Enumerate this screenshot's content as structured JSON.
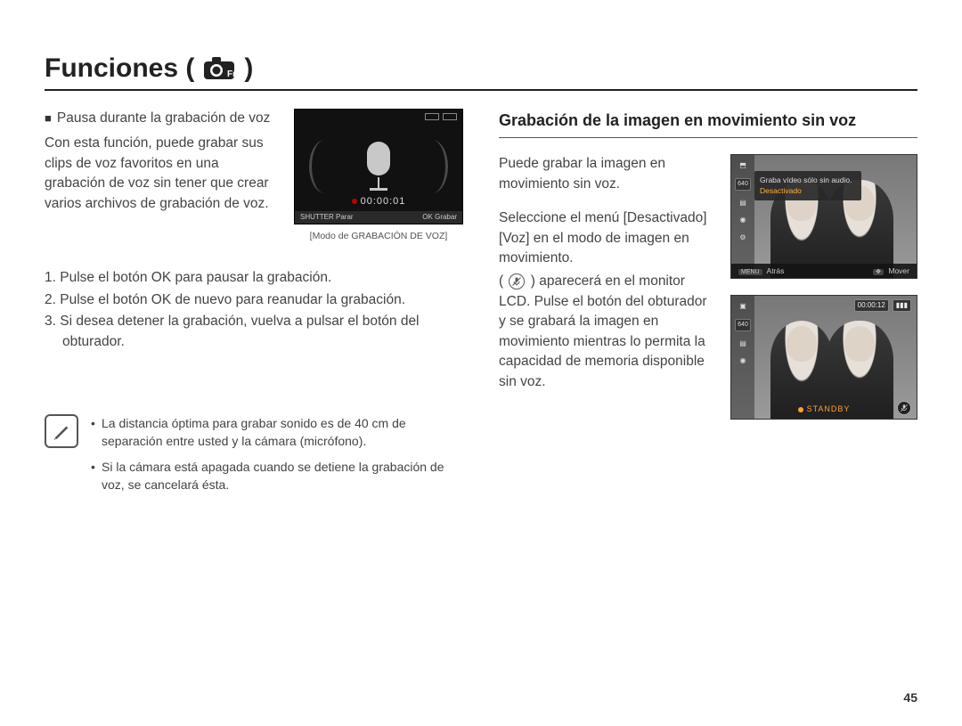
{
  "title": {
    "text": "Funciones (",
    "close": ")"
  },
  "left": {
    "subhead": "Pausa durante la grabación de voz",
    "paragraph": "Con esta función, puede grabar sus clips de voz favoritos en una grabación de voz sin tener que crear varios archivos de grabación de voz.",
    "voice_caption": "[Modo de GRABACIÓN DE VOZ]",
    "voice_timer": "00:00:01",
    "voice_bottom_left_key": "SHUTTER",
    "voice_bottom_left_label": "Parar",
    "voice_bottom_right_key": "OK",
    "voice_bottom_right_label": "Grabar",
    "steps": {
      "s1": "1. Pulse el botón OK para pausar la grabación.",
      "s2": "2. Pulse el botón OK de nuevo para reanudar la grabación.",
      "s3a": "3. Si desea detener la grabación, vuelva a pulsar el botón del",
      "s3b": "obturador."
    },
    "notes": {
      "n1": "La distancia óptima para grabar sonido es de 40 cm de separación entre usted y la cámara (micrófono).",
      "n2": "Si la cámara está apagada cuando se detiene la grabación de voz, se cancelará ésta."
    }
  },
  "right": {
    "heading": "Grabación de la imagen en movimiento sin voz",
    "p1": "Puede grabar la imagen en movimiento sin voz.",
    "p2a": "Seleccione el menú [Desactivado] [Voz] en el modo de imagen en movimiento.",
    "p2b_open": "(",
    "p2b_close": ") aparecerá en el monitor LCD. Pulse el botón del obturador y se grabará la imagen en movimiento mientras lo permita la capacidad de memoria disponible sin voz.",
    "lcd1": {
      "res": "640",
      "menu_line1": "Graba vídeo sólo sin audio.",
      "menu_line2": "Desactivado",
      "bottom_left_key": "MENU",
      "bottom_left_label": "Atrás",
      "bottom_right_label": "Mover"
    },
    "lcd2": {
      "res": "640",
      "timer": "00:00:12",
      "standby": "STANDBY"
    }
  },
  "page_number": "45"
}
